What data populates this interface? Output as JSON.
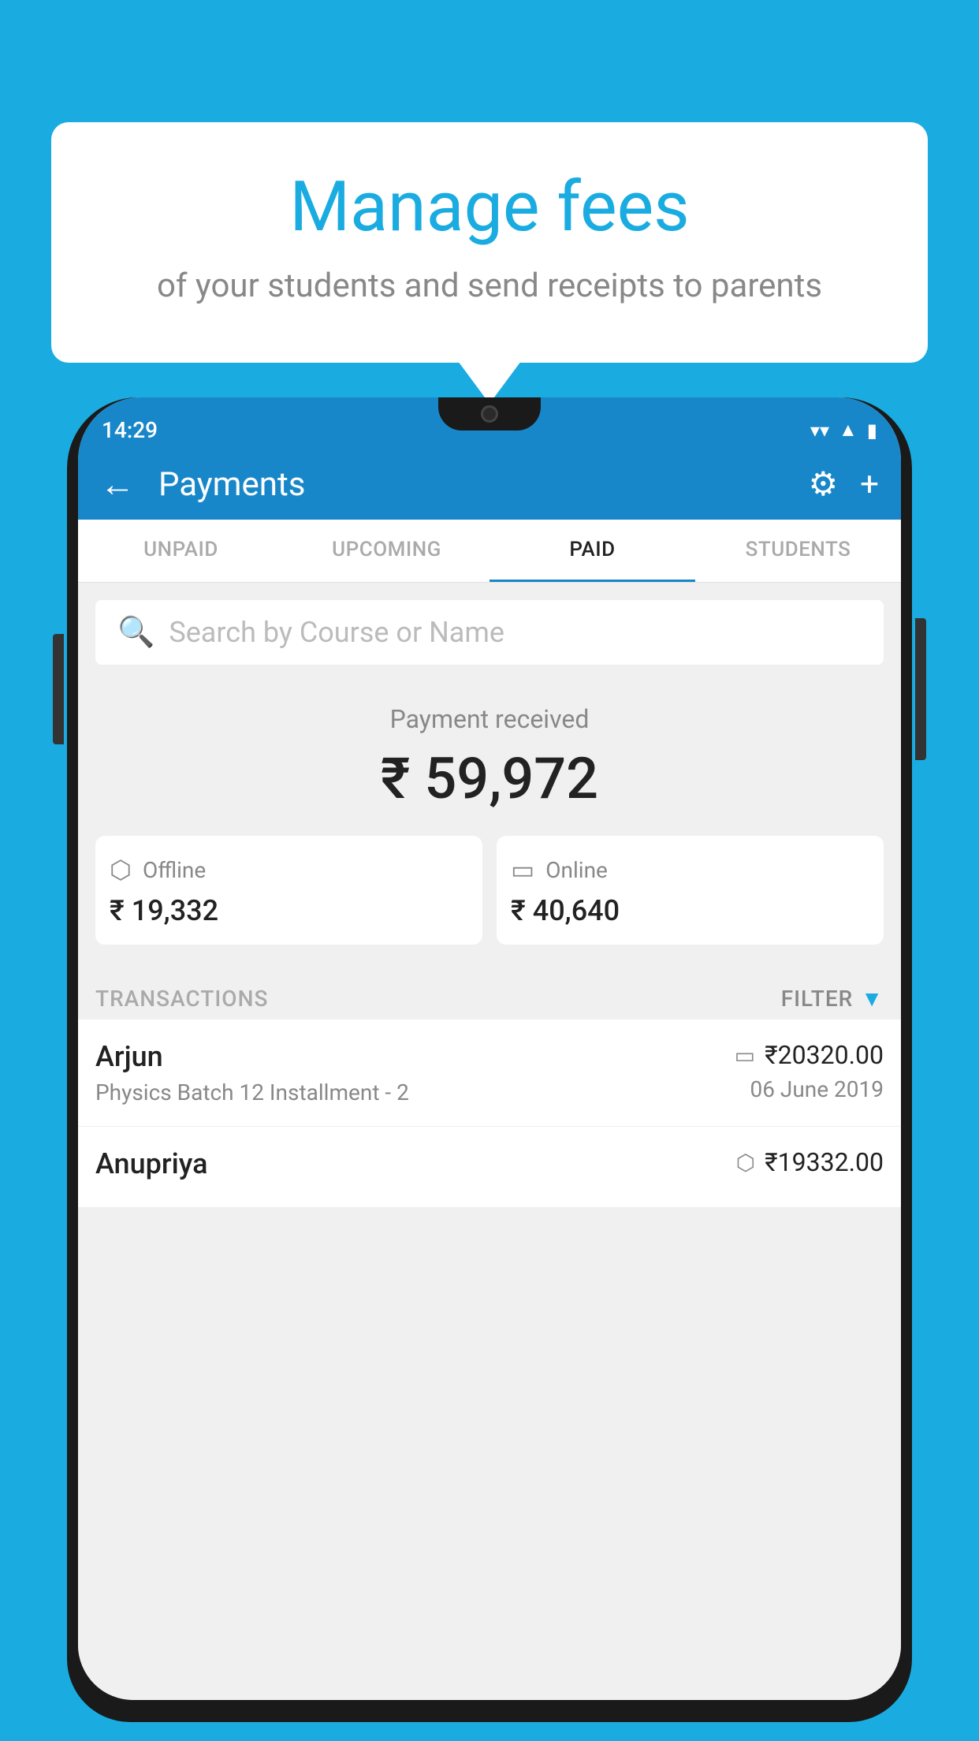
{
  "background_color": "#1AACE0",
  "speech_bubble": {
    "title": "Manage fees",
    "subtitle": "of your students and send receipts to parents"
  },
  "status_bar": {
    "time": "14:29",
    "wifi": "▼",
    "signal": "▲",
    "battery": "▮"
  },
  "header": {
    "title": "Payments",
    "back_label": "←",
    "gear_label": "⚙",
    "plus_label": "+"
  },
  "tabs": [
    {
      "id": "unpaid",
      "label": "UNPAID",
      "active": false
    },
    {
      "id": "upcoming",
      "label": "UPCOMING",
      "active": false
    },
    {
      "id": "paid",
      "label": "PAID",
      "active": true
    },
    {
      "id": "students",
      "label": "STUDENTS",
      "active": false
    }
  ],
  "search": {
    "placeholder": "Search by Course or Name"
  },
  "payment_summary": {
    "received_label": "Payment received",
    "total_amount": "₹ 59,972",
    "offline_label": "Offline",
    "offline_amount": "₹ 19,332",
    "online_label": "Online",
    "online_amount": "₹ 40,640"
  },
  "transactions": {
    "header_label": "TRANSACTIONS",
    "filter_label": "FILTER",
    "rows": [
      {
        "name": "Arjun",
        "detail": "Physics Batch 12 Installment - 2",
        "amount": "₹20320.00",
        "date": "06 June 2019",
        "icon": "card"
      },
      {
        "name": "Anupriya",
        "detail": "",
        "amount": "₹19332.00",
        "date": "",
        "icon": "cash"
      }
    ]
  }
}
